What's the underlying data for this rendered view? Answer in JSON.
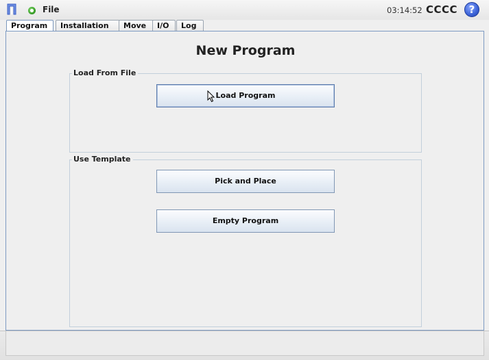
{
  "header": {
    "menu_label": "File",
    "clock": "03:14:52",
    "robot_name": "CCCC",
    "help_symbol": "?",
    "logo_icon": "ur-logo-icon",
    "status_icon": "status-ok-icon",
    "status_color": "#3fa52e",
    "help_color": "#3b62d6"
  },
  "tabs": [
    {
      "label": "Program",
      "active": true
    },
    {
      "label": "Installation",
      "active": false
    },
    {
      "label": "Move",
      "active": false
    },
    {
      "label": "I/O",
      "active": false
    },
    {
      "label": "Log",
      "active": false
    }
  ],
  "main": {
    "title": "New Program",
    "load_group": {
      "legend": "Load From File",
      "load_button": "Load Program"
    },
    "template_group": {
      "legend": "Use Template",
      "pick_place_button": "Pick and Place",
      "empty_program_button": "Empty Program"
    }
  }
}
